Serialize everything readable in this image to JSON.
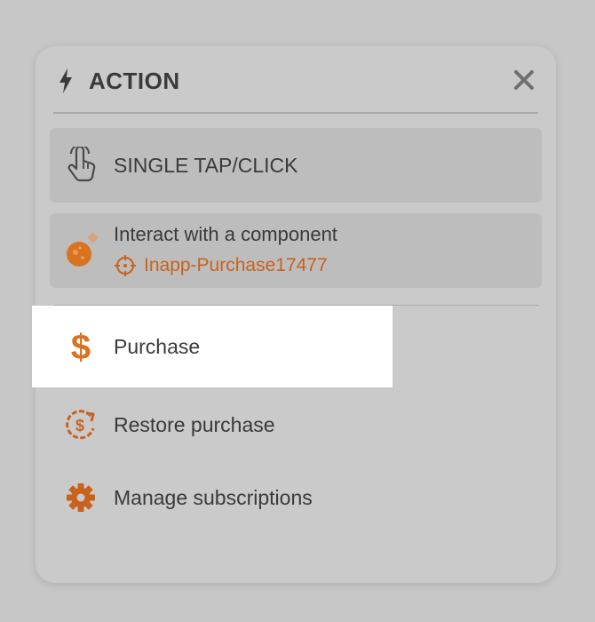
{
  "header": {
    "title": "ACTION",
    "icon": "lightning-icon",
    "close_icon": "close-icon"
  },
  "cards": {
    "single_tap": {
      "label": "SINGLE TAP/CLICK",
      "icon": "tap-gesture-icon"
    },
    "interact": {
      "label": "Interact with a component",
      "icon": "component-thumbnail-icon",
      "target_icon": "crosshair-target-icon",
      "target_label": "Inapp-Purchase17477"
    }
  },
  "actions": [
    {
      "label": "Purchase",
      "icon": "dollar-icon",
      "selected": true
    },
    {
      "label": "Restore purchase",
      "icon": "restore-dollar-icon",
      "selected": false
    },
    {
      "label": "Manage subscriptions",
      "icon": "gear-icon",
      "selected": false
    }
  ],
  "colors": {
    "accent": "#d9731f",
    "text": "#3a3a3a",
    "panel": "#cacaca",
    "card": "#bdbdbd",
    "selected_bg": "#ffffff",
    "link": "#c8621c"
  }
}
